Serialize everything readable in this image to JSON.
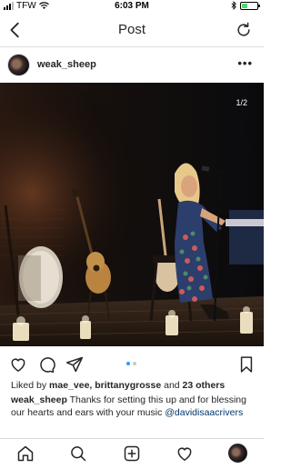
{
  "status_bar": {
    "carrier": "TFW",
    "time": "6:03 PM",
    "battery_level_percent": 40
  },
  "header": {
    "title": "Post"
  },
  "post": {
    "username": "weak_sheep",
    "more_label": "•••",
    "media_index_label": "1/2",
    "carousel": {
      "count": 2,
      "active": 0
    },
    "likes": {
      "prefix": "Liked by ",
      "user1": "mae_vee",
      "separator": ", ",
      "user2": "brittanygrosse",
      "middle": " and ",
      "others": "23 others"
    },
    "caption": {
      "username": "weak_sheep",
      "text": " Thanks for setting this up and for blessing our hearts and ears with your music ",
      "mention": "@davidisaacrivers"
    }
  },
  "icons": {
    "back": "chevron-left-icon",
    "refresh": "refresh-icon",
    "like": "heart-icon",
    "comment": "comment-icon",
    "share": "send-icon",
    "save": "bookmark-icon",
    "home": "home-icon",
    "search": "search-icon",
    "add": "add-post-icon",
    "activity": "heart-icon"
  },
  "colors": {
    "text": "#262626",
    "divider": "#dbdbdb",
    "carousel_active": "#3897f0",
    "carousel_inactive": "#c7c7c7",
    "battery": "#4cd964"
  }
}
